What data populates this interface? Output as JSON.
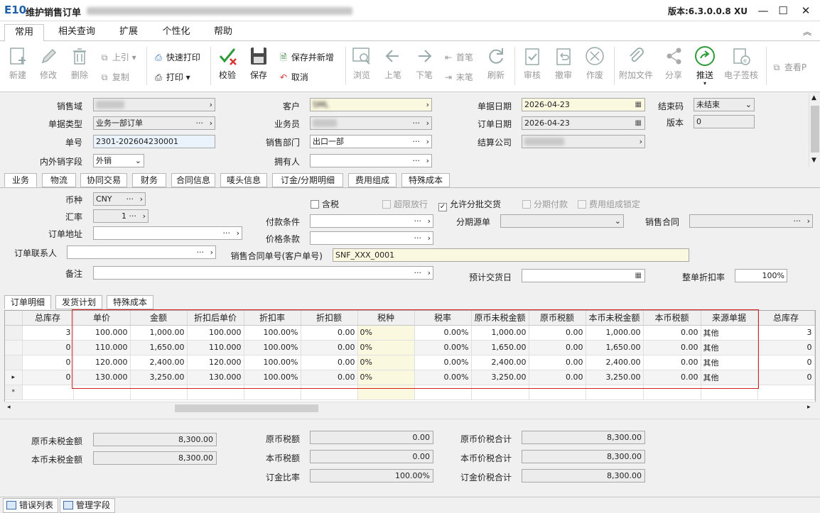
{
  "window": {
    "logo": "E10",
    "title": "维护销售订单",
    "version": "版本:6.3.0.0.8 XU",
    "min_glyph": "—",
    "max_glyph": "☐",
    "close_glyph": "✕"
  },
  "menu_tabs": [
    "常用",
    "相关查询",
    "扩展",
    "个性化",
    "帮助"
  ],
  "toolbar": {
    "new": "新建",
    "edit": "修改",
    "delete": "删除",
    "prev_ref": "上引",
    "copy": "复制",
    "quick_print": "快速打印",
    "print": "打印",
    "verify": "校验",
    "save": "保存",
    "save_new": "保存并新增",
    "cancel": "取消",
    "browse": "浏览",
    "prev": "上笔",
    "next": "下笔",
    "first": "首笔",
    "last": "末笔",
    "refresh": "刷新",
    "approve": "审核",
    "unapprove": "撤审",
    "void": "作废",
    "attach": "附加文件",
    "share": "分享",
    "push": "推送",
    "esign": "电子签核",
    "view": "查看P"
  },
  "header": {
    "sales_domain_label": "销售域",
    "doc_type_label": "单据类型",
    "doc_type_value": "业务一部订单",
    "doc_no_label": "单号",
    "doc_no_value": "2301-202604230001",
    "domestic_label": "内外销字段",
    "domestic_value": "外销",
    "customer_label": "客户",
    "customer_value": "SML",
    "salesman_label": "业务员",
    "dept_label": "销售部门",
    "dept_value": "出口一部",
    "owner_label": "拥有人",
    "doc_date_label": "单据日期",
    "doc_date_value": "2026-04-23",
    "order_date_label": "订单日期",
    "order_date_value": "2026-04-23",
    "settle_co_label": "结算公司",
    "close_code_label": "结束码",
    "close_code_value": "未结束",
    "version_label": "版本",
    "version_value": "0"
  },
  "sub_tabs": [
    "业务",
    "物流",
    "协同交易",
    "财务",
    "合同信息",
    "唛头信息",
    "订金/分期明细",
    "费用组成",
    "特殊成本"
  ],
  "business": {
    "currency_label": "币种",
    "currency_value": "CNY",
    "rate_label": "汇率",
    "rate_value": "1",
    "order_addr_label": "订单地址",
    "contact_label": "订单联系人",
    "remark_label": "备注",
    "tax_included_label": "含税",
    "over_limit_label": "超限放行",
    "allow_batch_label": "允许分批交货",
    "installment_label": "分期付款",
    "fee_lock_label": "费用组成锁定",
    "payment_terms_label": "付款条件",
    "price_terms_label": "价格条款",
    "contract_no_label": "销售合同单号(客户单号)",
    "contract_no_value": "SNF_XXX_0001",
    "installment_src_label": "分期源单",
    "sales_contract_label": "销售合同",
    "est_delivery_label": "预计交货日",
    "discount_label": "整单折扣率",
    "discount_value": "100%"
  },
  "detail_tabs": [
    "订单明细",
    "发货计划",
    "特殊成本"
  ],
  "grid": {
    "columns": [
      "总库存",
      "单价",
      "金额",
      "折扣后单价",
      "折扣率",
      "折扣额",
      "税种",
      "税率",
      "原币未税金额",
      "原币税额",
      "本币未税金额",
      "本币税额",
      "来源单据",
      "总库存"
    ],
    "rows": [
      [
        "3",
        "100.000",
        "1,000.00",
        "100.000",
        "100.00%",
        "0.00",
        "0%",
        "0.00%",
        "1,000.00",
        "0.00",
        "1,000.00",
        "0.00",
        "其他",
        "3"
      ],
      [
        "0",
        "110.000",
        "1,650.00",
        "110.000",
        "100.00%",
        "0.00",
        "0%",
        "0.00%",
        "1,650.00",
        "0.00",
        "1,650.00",
        "0.00",
        "其他",
        "0"
      ],
      [
        "0",
        "120.000",
        "2,400.00",
        "120.000",
        "100.00%",
        "0.00",
        "0%",
        "0.00%",
        "2,400.00",
        "0.00",
        "2,400.00",
        "0.00",
        "其他",
        "0"
      ],
      [
        "0",
        "130.000",
        "3,250.00",
        "130.000",
        "100.00%",
        "0.00",
        "0%",
        "0.00%",
        "3,250.00",
        "0.00",
        "3,250.00",
        "0.00",
        "其他",
        "0"
      ]
    ],
    "new_row_marker": "*",
    "current_row_marker": "▸"
  },
  "totals": {
    "orig_untaxed_label": "原币未税金额",
    "orig_untaxed_value": "8,300.00",
    "local_untaxed_label": "本币未税金额",
    "local_untaxed_value": "8,300.00",
    "orig_tax_label": "原币税额",
    "orig_tax_value": "0.00",
    "local_tax_label": "本币税额",
    "local_tax_value": "0.00",
    "deposit_rate_label": "订金比率",
    "deposit_rate_value": "100.00%",
    "orig_total_label": "原币价税合计",
    "orig_total_value": "8,300.00",
    "local_total_label": "本币价税合计",
    "local_total_value": "8,300.00",
    "deposit_total_label": "订金价税合计",
    "deposit_total_value": "8,300.00"
  },
  "statusbar": {
    "errors_tab": "错误列表",
    "fields_tab": "管理字段"
  }
}
